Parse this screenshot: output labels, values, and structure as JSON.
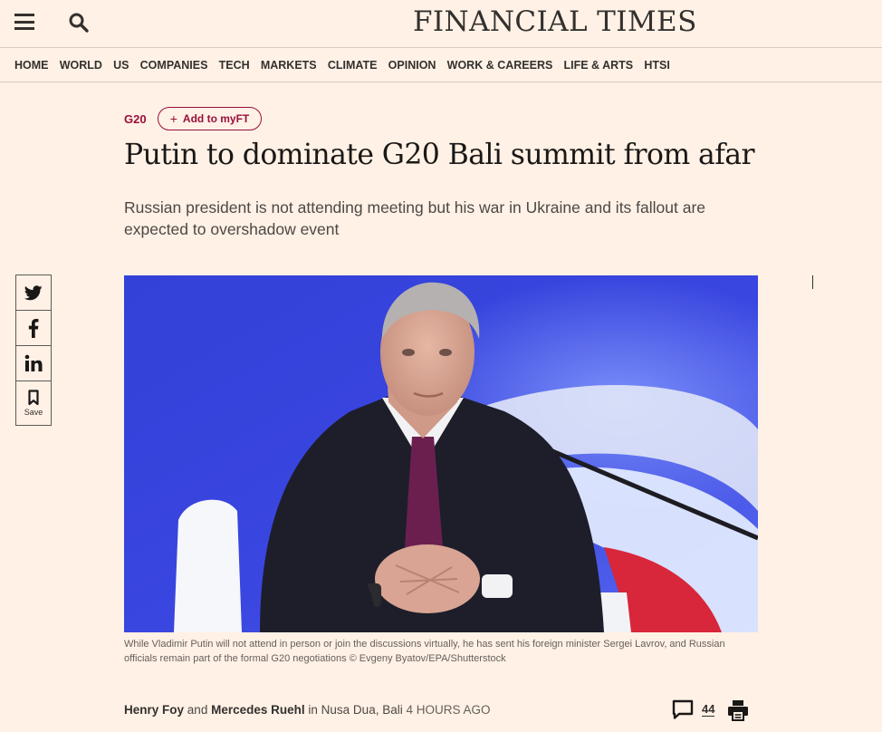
{
  "header": {
    "logo": "FINANCIAL TIMES"
  },
  "nav": {
    "items": [
      "HOME",
      "WORLD",
      "US",
      "COMPANIES",
      "TECH",
      "MARKETS",
      "CLIMATE",
      "OPINION",
      "WORK & CAREERS",
      "LIFE & ARTS",
      "HTSI"
    ]
  },
  "article": {
    "topic": "G20",
    "myft_label": "Add to myFT",
    "headline": "Putin to dominate G20 Bali summit from afar",
    "standfirst": "Russian president is not attending meeting but his war in Ukraine and its fallout are expected to overshadow event",
    "caption": "While Vladimir Putin will not attend in person or join the discussions virtually, he has sent his foreign minister Sergei Lavrov, and Russian officials remain part of the formal G20 negotiations © Evgeny Byatov/EPA/Shutterstock",
    "byline": {
      "author1": "Henry Foy",
      "and": "and",
      "author2": "Mercedes Ruehl",
      "location": "in Nusa Dua, Bali",
      "time": "4 hours ago"
    },
    "comments_count": "44"
  },
  "share": {
    "save_label": "Save",
    "icons": [
      "twitter-icon",
      "facebook-icon",
      "linkedin-icon",
      "bookmark-icon"
    ]
  },
  "colors": {
    "background": "#fff1e5",
    "claret": "#990f3d",
    "text": "#33302e"
  }
}
